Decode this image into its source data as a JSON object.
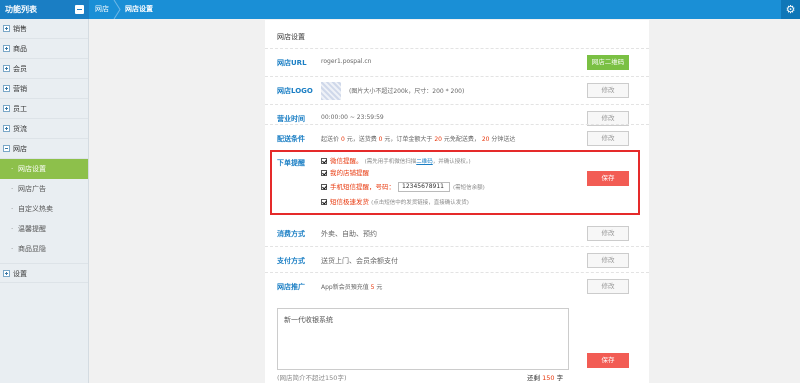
{
  "sidebar": {
    "title": "功能列表",
    "items": [
      {
        "label": "销售"
      },
      {
        "label": "商品"
      },
      {
        "label": "会员"
      },
      {
        "label": "营销"
      },
      {
        "label": "员工"
      },
      {
        "label": "货流"
      },
      {
        "label": "网店"
      }
    ],
    "sub_items": [
      {
        "label": "网店设置"
      },
      {
        "label": "网店广告"
      },
      {
        "label": "自定义热卖"
      },
      {
        "label": "温馨提醒"
      },
      {
        "label": "商品显隐"
      }
    ],
    "settings_label": "设置"
  },
  "breadcrumb": {
    "first": "网店",
    "second": "网店设置"
  },
  "panel": {
    "title": "网店设置",
    "url": {
      "label": "网店URL",
      "value": "roger1.pospal.cn",
      "button": "网店二维码"
    },
    "logo": {
      "label": "网店LOGO",
      "hint": "(图片大小不超过200k，尺寸：200 * 200)",
      "button": "修改"
    },
    "hours": {
      "label": "营业时间",
      "value": "00:00:00 ~ 23:59:59",
      "button": "修改"
    },
    "delivery": {
      "label": "配送条件",
      "p1": "起送价",
      "v1": "0",
      "p2": "元，送货费",
      "v2": "0",
      "p3": "元，订单金额大于",
      "v3": "20",
      "p4": "元免配送费，",
      "v4": "20",
      "p5": "分钟送达",
      "button": "修改"
    },
    "order_alert": {
      "label": "下单提醒",
      "wechat": "微信提醒。",
      "wechat_note_a": "(需先用手机微信扫描",
      "wechat_note_link": "二维码",
      "wechat_note_b": "，并确认授权。)",
      "store": "我的店铺提醒",
      "sms": "手机短信提醒，号码：",
      "phone": "12345678911",
      "sms_note": "(需短信余额)",
      "quick_ship": "短信极速发货",
      "quick_ship_note": "(点击短信中的发货链接，直接确认发货)",
      "button": "保存"
    },
    "consume": {
      "label": "消费方式",
      "value": "外卖、自助、预约",
      "button": "修改"
    },
    "payment": {
      "label": "支付方式",
      "value": "送货上门、会员余额支付",
      "button": "修改"
    },
    "promo": {
      "label": "网店推广",
      "text_a": "App新会员預充值",
      "amount": "5",
      "text_b": "元",
      "button": "修改"
    },
    "intro": {
      "value": "新一代收银系统",
      "hint": "(网店简介不超过150字)",
      "counter_a": "还剩",
      "counter_n": "150",
      "counter_b": "字",
      "button": "保存"
    }
  },
  "colors": {
    "header": "#1a8fd6",
    "active": "#8dc04b",
    "alert": "#e52a2a",
    "accent": "#e8380d"
  }
}
